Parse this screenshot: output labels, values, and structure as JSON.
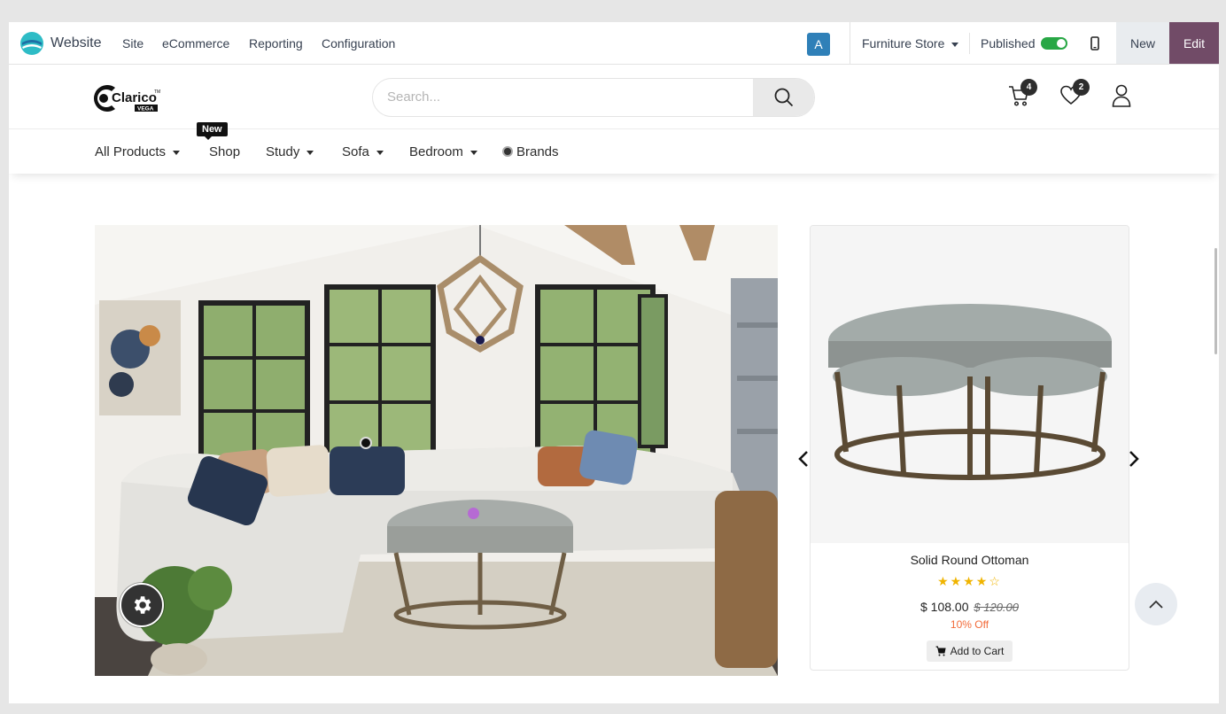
{
  "odoo_bar": {
    "app_name": "Website",
    "menus": [
      "Site",
      "eCommerce",
      "Reporting",
      "Configuration"
    ],
    "avatar_letter": "A",
    "store": "Furniture Store",
    "published_label": "Published",
    "published": true,
    "new_label": "New",
    "edit_label": "Edit",
    "edit_color": "#714b67",
    "avatar_color": "#2f80b8"
  },
  "header": {
    "logo_text": "Clarico",
    "logo_sub": "VEGA",
    "search_placeholder": "Search...",
    "cart_count": "4",
    "wishlist_count": "2"
  },
  "nav": {
    "items": [
      "All Products",
      "Shop",
      "Study",
      "Sofa",
      "Bedroom",
      "Brands"
    ],
    "new_badge": "New"
  },
  "product": {
    "name": "Solid Round Ottoman",
    "rating": 4,
    "rating_max": 5,
    "price": "$ 108.00",
    "old_price": "$ 120.00",
    "discount": "10% Off",
    "add_to_cart": "Add to Cart",
    "discount_color": "#f26b3a",
    "star_color": "#f0b400"
  }
}
